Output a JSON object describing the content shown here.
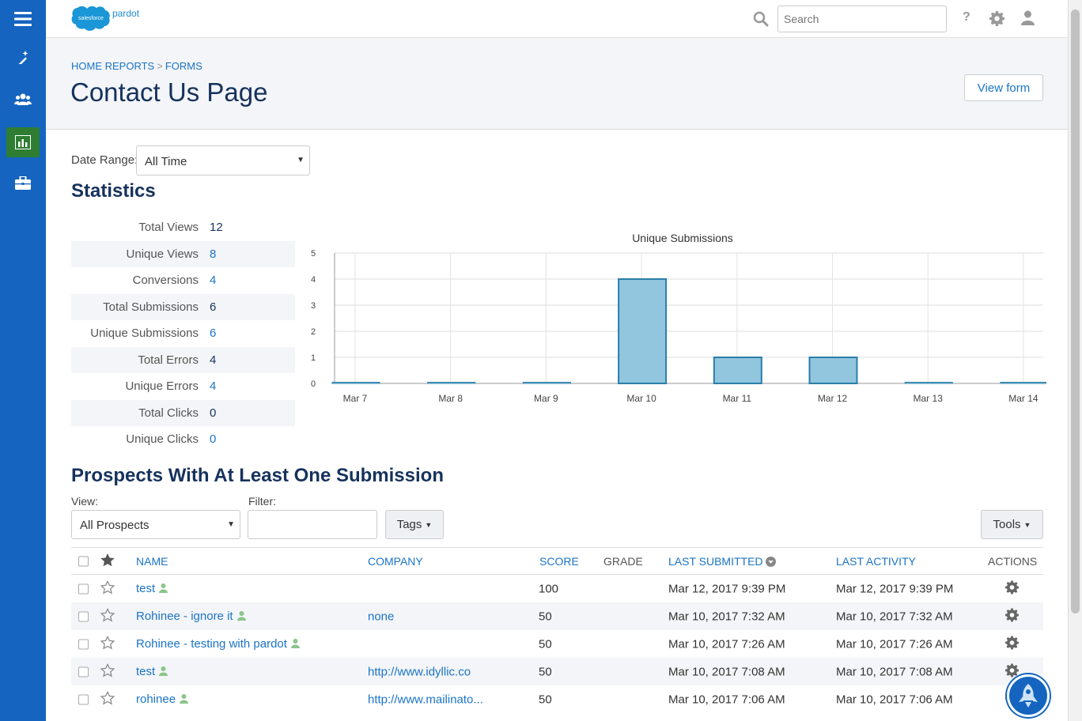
{
  "brand": {
    "name": "salesforce",
    "product": "pardot"
  },
  "search": {
    "placeholder": "Search"
  },
  "breadcrumb": {
    "home": "HOME",
    "reports": "REPORTS",
    "separator": ">",
    "forms": "FORMS"
  },
  "page_title": "Contact Us Page",
  "view_form_label": "View form",
  "date_range": {
    "label": "Date Range:",
    "value": "All Time"
  },
  "statistics": {
    "title": "Statistics",
    "rows": [
      {
        "label": "Total Views",
        "value": "12",
        "link": false
      },
      {
        "label": "Unique Views",
        "value": "8",
        "link": true
      },
      {
        "label": "Conversions",
        "value": "4",
        "link": true
      },
      {
        "label": "Total Submissions",
        "value": "6",
        "link": false
      },
      {
        "label": "Unique Submissions",
        "value": "6",
        "link": true
      },
      {
        "label": "Total Errors",
        "value": "4",
        "link": false
      },
      {
        "label": "Unique Errors",
        "value": "4",
        "link": true
      },
      {
        "label": "Total Clicks",
        "value": "0",
        "link": false
      },
      {
        "label": "Unique Clicks",
        "value": "0",
        "link": true
      }
    ]
  },
  "chart_data": {
    "type": "bar",
    "title": "Unique Submissions",
    "categories": [
      "Mar 7",
      "Mar 8",
      "Mar 9",
      "Mar 10",
      "Mar 11",
      "Mar 12",
      "Mar 13",
      "Mar 14"
    ],
    "values": [
      0,
      0,
      0,
      4,
      1,
      1,
      0,
      0
    ],
    "ylim": [
      0,
      5
    ],
    "yticks": [
      "0",
      "1",
      "2",
      "3",
      "4",
      "5"
    ],
    "grid": true,
    "bar_color": "#92c5de",
    "bar_border": "#2a7fa8"
  },
  "prospects": {
    "title": "Prospects With At Least One Submission",
    "view_label": "View:",
    "view_value": "All Prospects",
    "filter_label": "Filter:",
    "filter_value": "",
    "tags_label": "Tags",
    "tools_label": "Tools",
    "columns": {
      "name": "NAME",
      "company": "COMPANY",
      "score": "SCORE",
      "grade": "GRADE",
      "last_submitted": "LAST SUBMITTED",
      "last_activity": "LAST ACTIVITY",
      "actions": "ACTIONS"
    },
    "rows": [
      {
        "name": "test",
        "company": "",
        "score": "100",
        "grade": "",
        "last_submitted": "Mar 12, 2017 9:39 PM",
        "last_activity": "Mar 12, 2017 9:39 PM"
      },
      {
        "name": "Rohinee - ignore it",
        "company": "none",
        "score": "50",
        "grade": "",
        "last_submitted": "Mar 10, 2017 7:32 AM",
        "last_activity": "Mar 10, 2017 7:32 AM"
      },
      {
        "name": "Rohinee - testing with pardot",
        "company": "",
        "score": "50",
        "grade": "",
        "last_submitted": "Mar 10, 2017 7:26 AM",
        "last_activity": "Mar 10, 2017 7:26 AM"
      },
      {
        "name": "test",
        "company": "http://www.idyllic.co",
        "score": "50",
        "grade": "",
        "last_submitted": "Mar 10, 2017 7:08 AM",
        "last_activity": "Mar 10, 2017 7:08 AM"
      },
      {
        "name": "rohinee",
        "company": "http://www.mailinato...",
        "score": "50",
        "grade": "",
        "last_submitted": "Mar 10, 2017 7:06 AM",
        "last_activity": "Mar 10, 2017 7:06 AM"
      }
    ]
  },
  "colors": {
    "sidebar": "#1565c0",
    "active_nav": "#2e7d32",
    "link": "#1b74c5",
    "title": "#16325c"
  },
  "icons": [
    "hamburger-icon",
    "magic-wand-icon",
    "users-icon",
    "reports-chart-icon",
    "briefcase-icon",
    "search-icon",
    "help-icon",
    "gear-icon",
    "user-icon",
    "star-icon",
    "person-icon",
    "chat-widget-icon"
  ]
}
